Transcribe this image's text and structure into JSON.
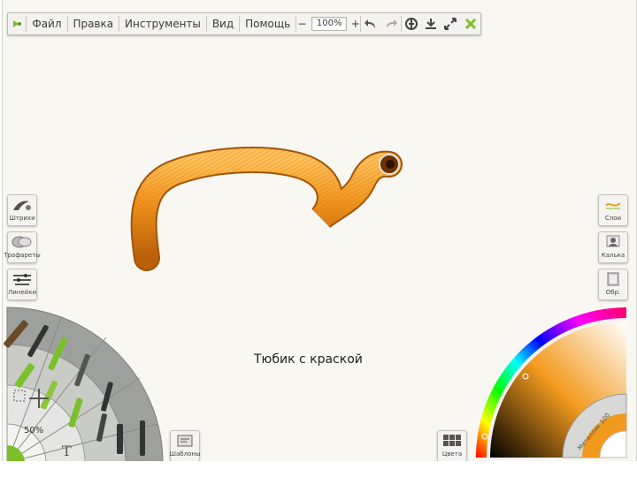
{
  "menu": {
    "file": "Файл",
    "edit": "Правка",
    "tools": "Инструменты",
    "view": "Вид",
    "help": "Помощь"
  },
  "zoom": {
    "minus": "−",
    "value": "100%",
    "plus": "+"
  },
  "icons": [
    "app-logo-icon",
    "undo-icon",
    "redo-icon",
    "symmetry-icon",
    "save-icon",
    "fullscreen-icon",
    "close-x-icon"
  ],
  "left_panel": {
    "strokes": "Штрихи",
    "stencils": "Трафареты",
    "rulers": "Линейки"
  },
  "right_panel": {
    "layers": "Слои",
    "tracing": "Калька",
    "paper": "Обр."
  },
  "brush_wheel": {
    "opacity": "50%"
  },
  "bottom_buttons": {
    "templates": "Шаблоны",
    "palette": "Цвета"
  },
  "color_wheel": {
    "material_label": "Металлик 100"
  },
  "caption": "Тюбик с краской",
  "colors": {
    "paint": "#f29a1e",
    "accent": "#7bbf2a"
  }
}
